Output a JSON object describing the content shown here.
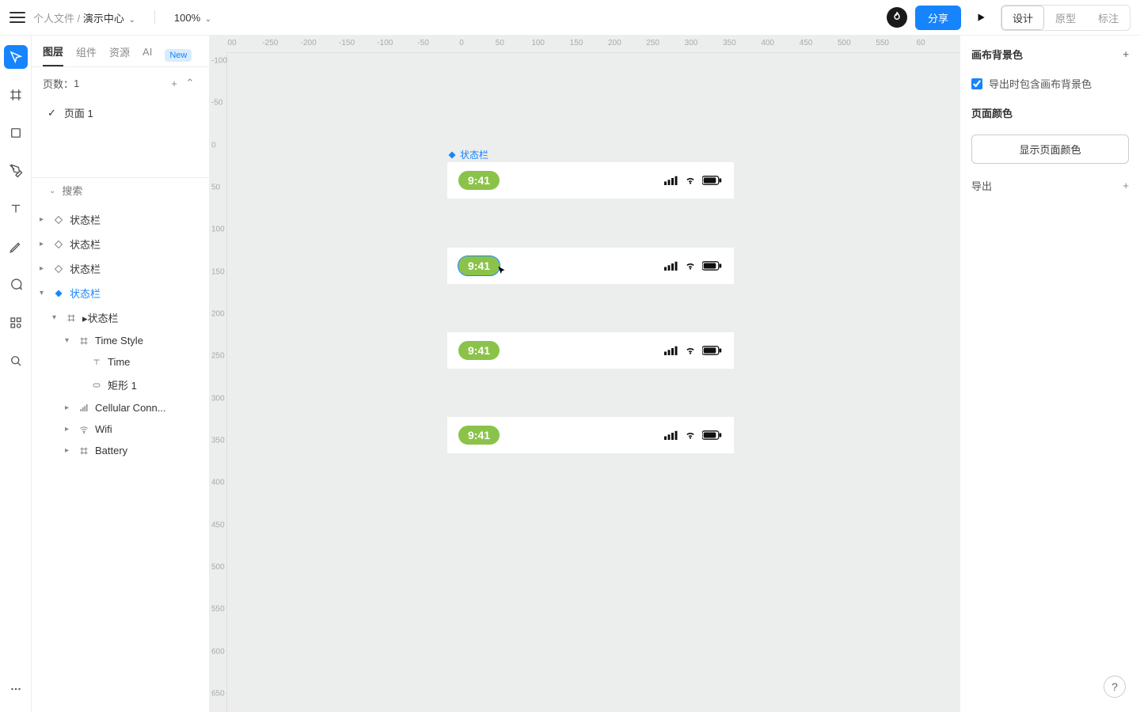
{
  "topbar": {
    "breadcrumb_root": "个人文件 /",
    "breadcrumb_leaf": "演示中心",
    "zoom": "100%",
    "share": "分享",
    "tabs": {
      "design": "设计",
      "prototype": "原型",
      "annotate": "标注"
    }
  },
  "left_panel": {
    "tabs": {
      "layers": "图层",
      "components": "组件",
      "resources": "资源",
      "ai": "AI",
      "new_badge": "New"
    },
    "pages_label": "页数：",
    "pages_count": "1",
    "page1": "页面 1",
    "search_placeholder": "搜索"
  },
  "layers": {
    "status_bar": "状态栏",
    "status_bar_master": "▸状态栏",
    "time_style": "Time Style",
    "time": "Time",
    "rect1": "矩形 1",
    "cellular": "Cellular Conn...",
    "wifi": "Wifi",
    "battery": "Battery"
  },
  "canvas": {
    "selected_label": "状态栏",
    "time": "9:41",
    "ruler_h": [
      "00",
      "-250",
      "-200",
      "-150",
      "-100",
      "-50",
      "0",
      "50",
      "100",
      "150",
      "200",
      "250",
      "300",
      "350",
      "400",
      "450",
      "500",
      "550",
      "60"
    ],
    "ruler_v": [
      "-100",
      "-50",
      "0",
      "50",
      "100",
      "150",
      "200",
      "250",
      "300",
      "350",
      "400",
      "450",
      "500",
      "550",
      "600",
      "650"
    ]
  },
  "right_panel": {
    "bg_title": "画布背景色",
    "export_bg": "导出时包含画布背景色",
    "page_color_title": "页面颜色",
    "show_page_color": "显示页面颜色",
    "export": "导出"
  },
  "help": "?"
}
